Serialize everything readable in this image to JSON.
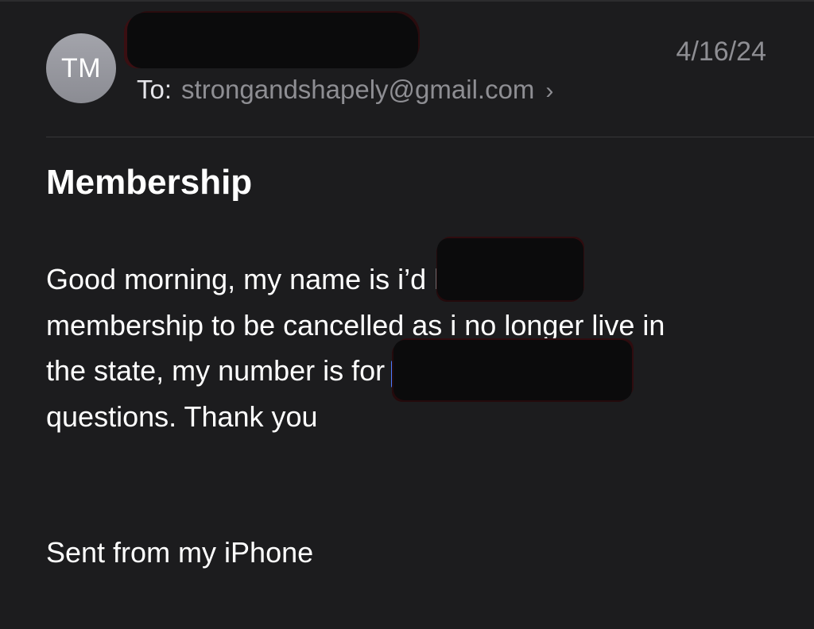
{
  "header": {
    "avatar_initials": "TM",
    "date": "4/16/24",
    "to_label": "To:",
    "to_address": "strongandshapely@gmail.com",
    "chevron_icon": "chevron-right-icon"
  },
  "email": {
    "subject": "Membership",
    "body_lines": [
      "Good morning, my name is                         i’d like my",
      "membership to be cancelled as i no longer live in",
      "the state, my number is                                    for any",
      "questions. Thank you"
    ],
    "signature": "Sent from my iPhone"
  },
  "colors": {
    "background": "#1c1c1e",
    "secondary_text": "#8e8e93",
    "link": "#4a7dff",
    "avatar": "#9a9ba2"
  }
}
